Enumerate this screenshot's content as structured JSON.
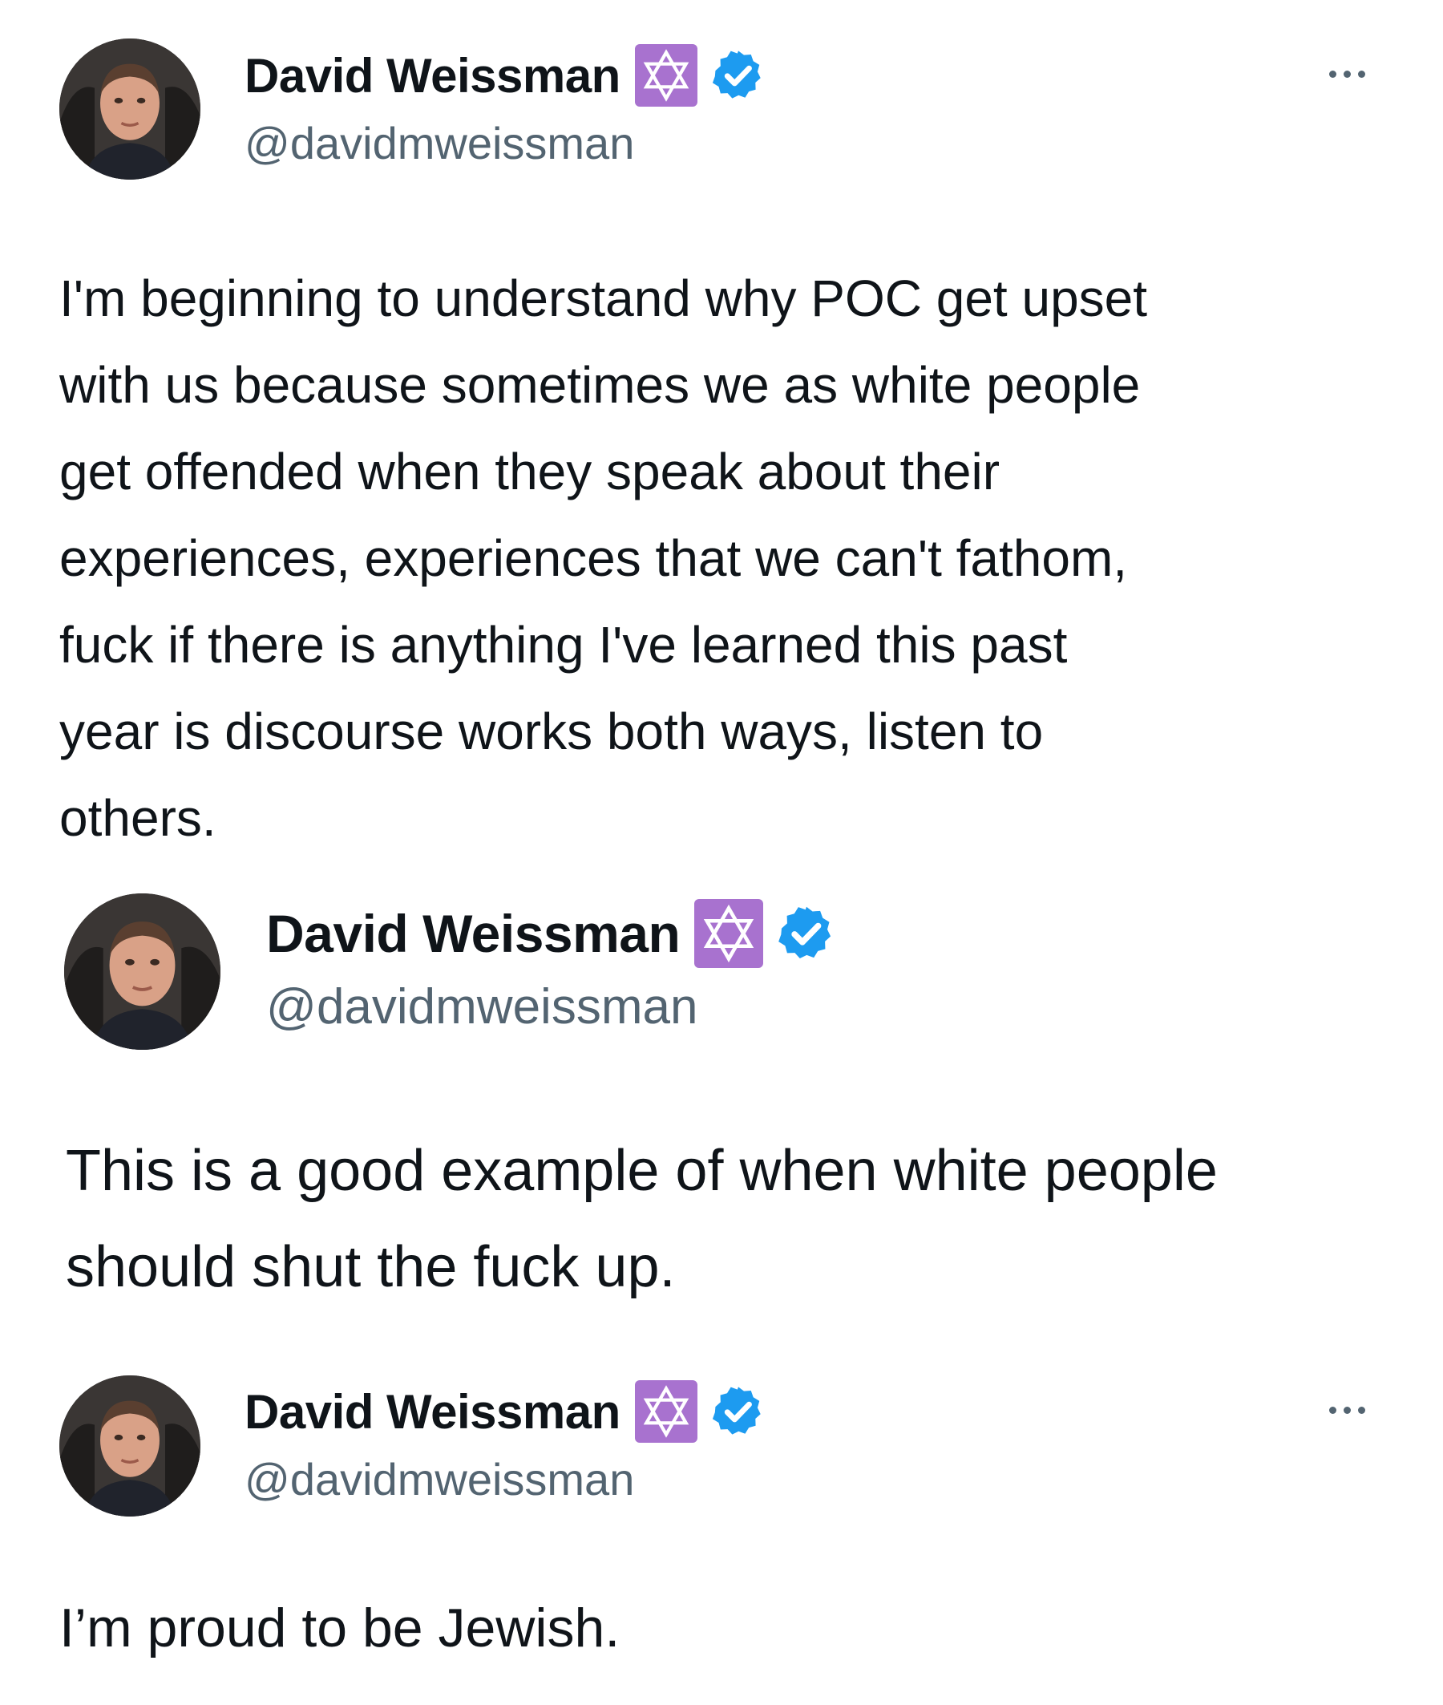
{
  "tweets": [
    {
      "display_name": "David Weissman",
      "handle": "@davidmweissman",
      "text": "I'm beginning to understand why POC get upset\nwith us because sometimes we as white people\nget offended when they speak about their\nexperiences, experiences that we can't fathom,\nfuck if there is anything I've learned this past\nyear is discourse works both ways, listen to\nothers.",
      "icons": [
        "avatar",
        "star-of-david-badge-icon",
        "verified-badge-icon",
        "more-options-icon"
      ]
    },
    {
      "display_name": "David Weissman",
      "handle": "@davidmweissman",
      "text": "This is a good example of when white people\nshould shut the fuck up.",
      "icons": [
        "avatar",
        "star-of-david-badge-icon",
        "verified-badge-icon"
      ]
    },
    {
      "display_name": "David Weissman",
      "handle": "@davidmweissman",
      "text": "I’m proud to be Jewish.",
      "icons": [
        "avatar",
        "star-of-david-badge-icon",
        "verified-badge-icon",
        "more-options-icon"
      ]
    }
  ],
  "colors": {
    "text": "#0f1419",
    "handle": "#536471",
    "badge": "#a872cf",
    "verified": "#1d9bf0"
  }
}
